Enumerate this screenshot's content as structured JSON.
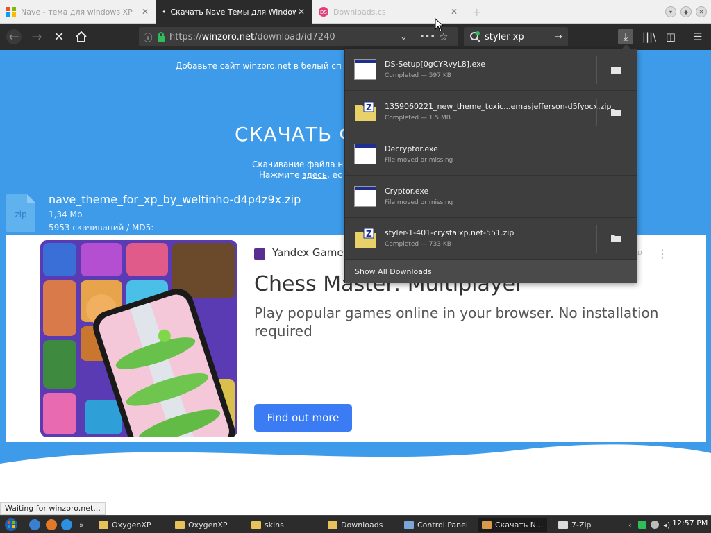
{
  "tabs": [
    {
      "label": "Nave - тема для windows XP",
      "close": "✕"
    },
    {
      "label": "Скачать Nave Темы для Windows XP",
      "close": "✕"
    },
    {
      "label": "Downloads.cs",
      "close": "✕"
    }
  ],
  "new_tab": "+",
  "urlbar": {
    "prefix": "https://",
    "host": "winzoro.net",
    "path": "/download/id7240"
  },
  "searchbar": {
    "query": "styler xp"
  },
  "page": {
    "banner": "Добавьте сайт winzoro.net в белый сп",
    "heading": "СКАЧАТЬ Ф",
    "sub_line1": "Скачивание файла н",
    "sub_line2_prefix": "Нажмите ",
    "sub_line2_link": "здесь",
    "sub_line2_suffix": ", ес",
    "file_icon_label": "zip",
    "file_name": "nave_theme_for_xp_by_weltinho-d4p4z9x.zip",
    "file_size": "1,34 Mb",
    "file_stats": "5953 скачиваний / MD5:"
  },
  "ad": {
    "brand": "Yandex Games",
    "ad_label": "AD",
    "title": "Chess Master: Multiplayer",
    "description": "Play popular games online in your browser. No installation required",
    "cta": "Find out more"
  },
  "downloads": {
    "items": [
      {
        "name": "DS-Setup[0gCYRvyL8].exe",
        "status": "Completed — 597 KB",
        "type": "exe",
        "has_folder": true
      },
      {
        "name": "1359060221_new_theme_toxic...emasjefferson-d5fyocx.zip",
        "status": "Completed — 1.5 MB",
        "type": "zip",
        "has_folder": true
      },
      {
        "name": "Decryptor.exe",
        "status": "File moved or missing",
        "type": "exe",
        "has_folder": false
      },
      {
        "name": "Cryptor.exe",
        "status": "File moved or missing",
        "type": "exe",
        "has_folder": false
      },
      {
        "name": "styler-1-401-crystalxp.net-551.zip",
        "status": "Completed — 733 KB",
        "type": "zip",
        "has_folder": true
      }
    ],
    "show_all": "Show All Downloads"
  },
  "status_text": "Waiting for winzoro.net...",
  "taskbar": {
    "start": "start",
    "items": [
      "OxygenXP",
      "OxygenXP",
      "skins",
      "Downloads",
      "Control Panel",
      "Скачать N...",
      "7-Zip"
    ],
    "clock": "12:57 PM"
  },
  "colors": {
    "page_bg": "#3d9be9",
    "toolbar_bg": "#2b2b2b",
    "cta": "#3b7cf5",
    "panel_bg": "#3e3e3e"
  }
}
